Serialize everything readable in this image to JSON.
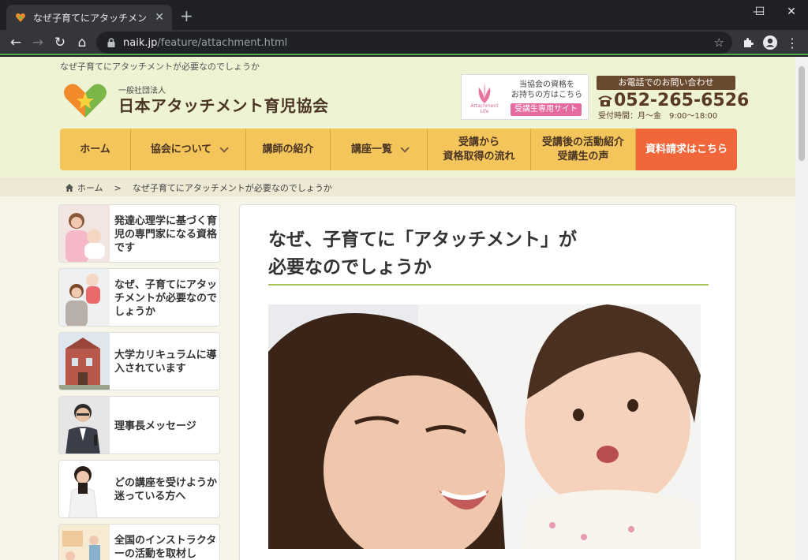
{
  "browser": {
    "tab_title": "なぜ子育てにアタッチメントが必要なの",
    "tab_close": "✕",
    "new_tab": "+",
    "url_domain": "naik.jp",
    "url_path": "/feature/attachment.html",
    "window_controls": [
      "—",
      "☐",
      "✕"
    ]
  },
  "header": {
    "tagline": "なぜ子育てにアタッチメントが必要なのでしょうか",
    "org_type": "一般社団法人",
    "org_name": "日本アタッチメント育児協会",
    "license": {
      "logo_text": "Attachment Life",
      "line1": "当協会の資格を",
      "line2": "お持ちの方はこちら",
      "button": "受講生専用サイト"
    },
    "tel": {
      "heading": "お電話でのお問い合わせ",
      "number": "052-265-6526",
      "hours": "受付時間：月～金　9:00～18:00"
    }
  },
  "nav": {
    "home": "ホーム",
    "about": "協会について",
    "instructors": "講師の紹介",
    "courses": "講座一覧",
    "flow_line1": "受講から",
    "flow_line2": "資格取得の流れ",
    "voices_line1": "受講後の活動紹介",
    "voices_line2": "受講生の声",
    "request": "資料請求はこちら"
  },
  "breadcrumb": {
    "home": "ホーム",
    "separator": ">",
    "current": "なぜ子育てにアタッチメントが必要なのでしょうか"
  },
  "sidebar": {
    "items": [
      {
        "label": "発達心理学に基づく育児の専門家になる資格です"
      },
      {
        "label": "なぜ、子育てにアタッチメントが必要なのでしょうか"
      },
      {
        "label": "大学カリキュラムに導入されています"
      },
      {
        "label": "理事長メッセージ"
      },
      {
        "label": "どの講座を受けようか迷っている方へ"
      },
      {
        "label": "全国のインストラクターの活動を取材し"
      }
    ]
  },
  "main": {
    "title_line1": "なぜ、子育てに「アタッチメント」が",
    "title_line2": "必要なのでしょうか"
  },
  "colors": {
    "nav_bg": "#f3c55a",
    "cta": "#f0663a",
    "header_bg": "#eef3d4",
    "accent_rule": "#a8c35a",
    "brown": "#5a3a24",
    "pink": "#e46aa0"
  },
  "icons": {
    "lock": "lock-icon",
    "star": "bookmark-star-icon",
    "phone": "phone-icon",
    "home": "home-icon"
  }
}
